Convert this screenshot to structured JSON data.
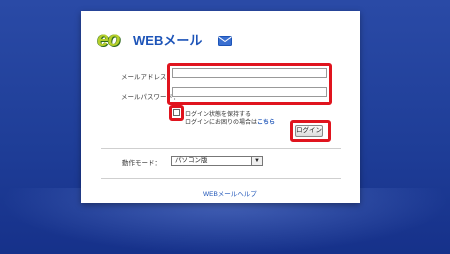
{
  "logo": {
    "eo_text": "eo",
    "service_name": "WEBメール"
  },
  "form": {
    "email_label": "メールアドレス：",
    "email_value": "",
    "password_label": "メールパスワード：",
    "password_value": "",
    "remember_label": "ログイン状態を保持する",
    "forgot_prefix": "ログインにお困りの場合は",
    "forgot_link": "こちら",
    "login_button": "ログイン"
  },
  "mode": {
    "label": "動作モード：",
    "selected": "パソコン版"
  },
  "footer": {
    "help_link": "WEBメールヘルプ"
  },
  "colors": {
    "highlight": "#e0141e",
    "brand_blue": "#1d54b8",
    "brand_green": "#b5cf2b",
    "background": "#1f3e98"
  }
}
